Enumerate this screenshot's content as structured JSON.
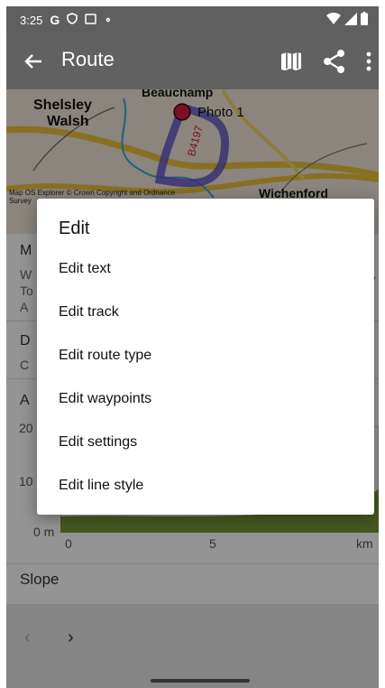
{
  "status_bar": {
    "time": "3:25",
    "icons": [
      "google-g-icon",
      "shield-icon",
      "screen-icon",
      "mic-icon",
      "wifi-icon",
      "cell-signal-icon",
      "battery-icon"
    ]
  },
  "app_bar": {
    "title": "Route",
    "actions": [
      "map-icon",
      "share-icon",
      "more-vert-icon"
    ]
  },
  "map": {
    "labels": [
      "Shelsley",
      "Walsh",
      "Beauchamp",
      "Photo 1",
      "B4197",
      "Wichenford"
    ],
    "copyright": "Map OS Explorer © Crown Copyright and Ordnance Survey"
  },
  "background_rows": {
    "letters": [
      "M",
      "D",
      "A"
    ],
    "sub_first": [
      "W",
      "To",
      "A"
    ],
    "sub_second": [
      "C"
    ],
    "chart_y_ticks": [
      "20",
      "10",
      "0 m"
    ],
    "chart_x_ticks": [
      "0",
      "5",
      "km"
    ],
    "slope_label": "Slope"
  },
  "dialog": {
    "title": "Edit",
    "items": [
      {
        "label": "Edit text"
      },
      {
        "label": "Edit track"
      },
      {
        "label": "Edit route type"
      },
      {
        "label": "Edit waypoints"
      },
      {
        "label": "Edit settings"
      },
      {
        "label": "Edit line style"
      }
    ]
  },
  "bottom_nav": {
    "prev_symbol": "‹",
    "next_symbol": "›"
  },
  "colors": {
    "app_bar": "#616161",
    "status_bar": "#5f5f5f",
    "elevation_fill": "#7a9a3a",
    "route_line": "#5a4fc8",
    "waypoint": "#d01b3a"
  }
}
